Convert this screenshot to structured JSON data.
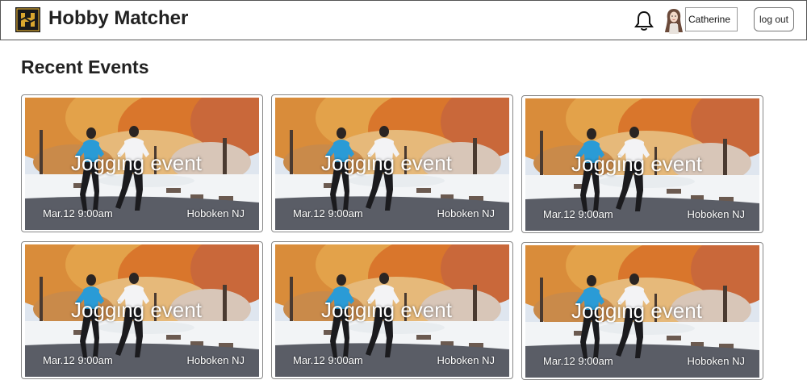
{
  "header": {
    "app_title": "Hobby Matcher",
    "user_name": "Catherine",
    "logout_label": "log out",
    "icons": {
      "logo": "hobby-matcher-logo",
      "notifications": "bell-icon",
      "user": "avatar"
    }
  },
  "main": {
    "section_title": "Recent Events",
    "events": [
      {
        "title": "Jogging event",
        "date": "Mar.12 9:00am",
        "location": "Hoboken NJ"
      },
      {
        "title": "Jogging event",
        "date": "Mar.12 9:00am",
        "location": "Hoboken NJ"
      },
      {
        "title": "Jogging event",
        "date": "Mar.12 9:00am",
        "location": "Hoboken NJ"
      },
      {
        "title": "Jogging event",
        "date": "Mar.12 9:00am",
        "location": "Hoboken NJ"
      },
      {
        "title": "Jogging event",
        "date": "Mar.12 9:00am",
        "location": "Hoboken NJ"
      },
      {
        "title": "Jogging event",
        "date": "Mar.12 9:00am",
        "location": "Hoboken NJ"
      }
    ]
  },
  "colors": {
    "logo_bg": "#1a1a1a",
    "logo_gold": "#d9a62e",
    "sky": "#dfe6ef",
    "foliage_orange": "#d9762c",
    "snow": "#f2f4f6",
    "road": "#5a5d66",
    "jacket_blue": "#2a9bd6"
  }
}
